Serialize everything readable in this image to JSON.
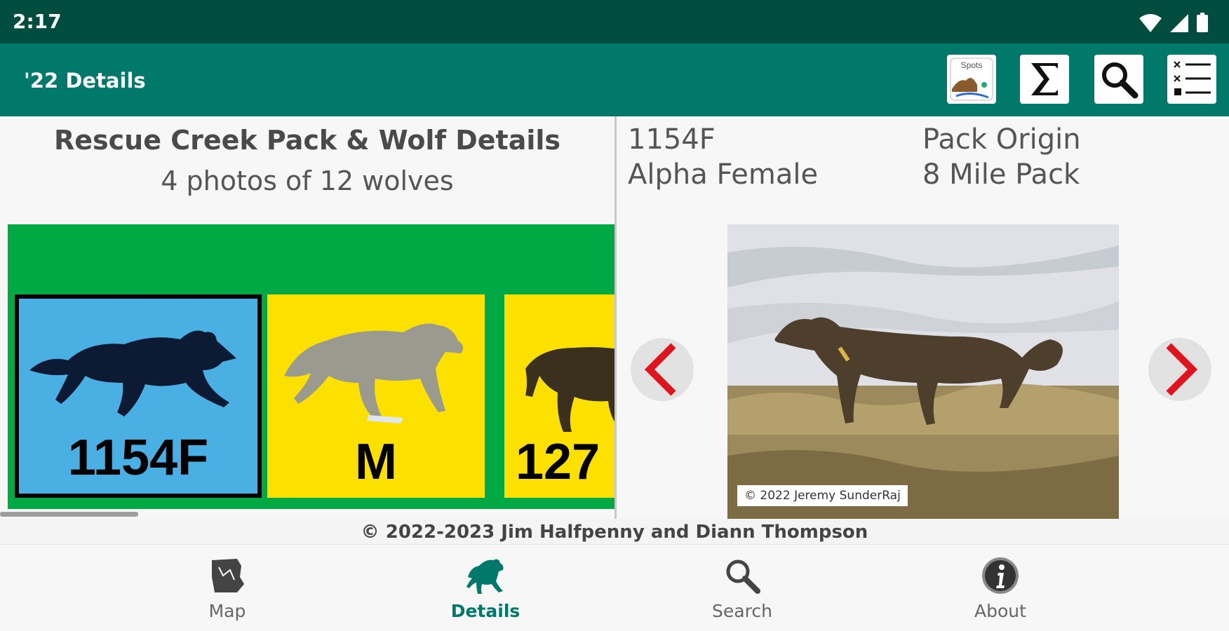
{
  "status": {
    "time": "2:17"
  },
  "appbar": {
    "title": "'22 Details",
    "actions": [
      {
        "icon": "spots-map-icon",
        "text": "Spots"
      },
      {
        "icon": "sigma-icon"
      },
      {
        "icon": "magnifier-icon"
      },
      {
        "icon": "list-icon"
      }
    ]
  },
  "pack": {
    "title": "Rescue Creek Pack & Wolf Details",
    "subtitle": "4 photos of 12 wolves",
    "cards": [
      {
        "label": "1154F",
        "color": "#4ab0e3",
        "selected": true
      },
      {
        "label": "M",
        "color": "#fce000",
        "selected": false
      },
      {
        "label": "127",
        "color": "#fce000",
        "selected": false
      }
    ]
  },
  "wolf": {
    "id": "1154F",
    "role": "Alpha Female",
    "origin_label": "Pack Origin",
    "origin_value": "8 Mile Pack",
    "photo_credit": "© 2022 Jeremy SunderRaj"
  },
  "footer": {
    "copyright": "© 2022-2023 Jim Halfpenny and Diann Thompson"
  },
  "bottomnav": {
    "items": [
      {
        "label": "Map",
        "icon": "map-icon",
        "active": false
      },
      {
        "label": "Details",
        "icon": "wolf-icon",
        "active": true
      },
      {
        "label": "Search",
        "icon": "search-icon",
        "active": false
      },
      {
        "label": "About",
        "icon": "info-icon",
        "active": false
      }
    ]
  },
  "colors": {
    "status": "#004d40",
    "appbar": "#00796b",
    "strip": "#00a944",
    "accent": "#00796b",
    "arrow": "#e0141c"
  }
}
